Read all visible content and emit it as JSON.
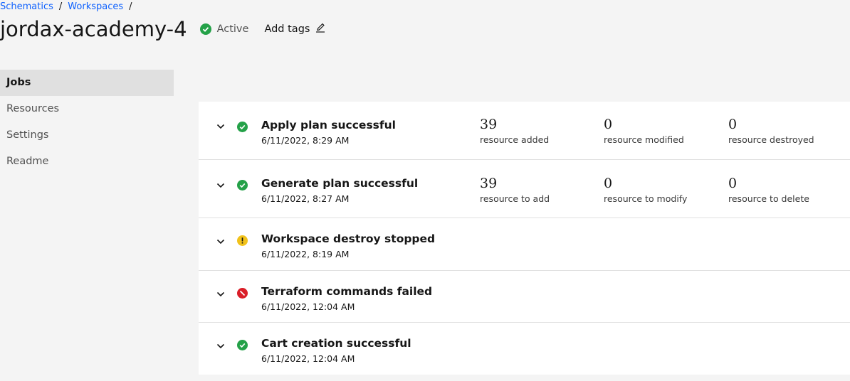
{
  "breadcrumb": {
    "items": [
      "Schematics",
      "Workspaces"
    ],
    "separator": "/"
  },
  "workspace": {
    "title": "jordax-academy-4",
    "status": "Active",
    "add_tags": "Add tags"
  },
  "nav": {
    "items": [
      "Jobs",
      "Resources",
      "Settings",
      "Readme"
    ],
    "active": "Jobs"
  },
  "colors": {
    "success": "#24a148",
    "warning": "#f1c21b",
    "error": "#da1e28",
    "link": "#0f62fe"
  },
  "jobs": [
    {
      "status": "success",
      "title": "Apply plan successful",
      "date": "6/11/2022, 8:29 AM",
      "metrics": [
        {
          "value": "39",
          "label": "resource added"
        },
        {
          "value": "0",
          "label": "resource modified"
        },
        {
          "value": "0",
          "label": "resource destroyed"
        }
      ]
    },
    {
      "status": "success",
      "title": "Generate plan successful",
      "date": "6/11/2022, 8:27 AM",
      "metrics": [
        {
          "value": "39",
          "label": "resource to add"
        },
        {
          "value": "0",
          "label": "resource to modify"
        },
        {
          "value": "0",
          "label": "resource to delete"
        }
      ]
    },
    {
      "status": "warning",
      "title": "Workspace destroy stopped",
      "date": "6/11/2022, 8:19 AM"
    },
    {
      "status": "error",
      "title": "Terraform commands failed",
      "date": "6/11/2022, 12:04 AM"
    },
    {
      "status": "success",
      "title": "Cart creation successful",
      "date": "6/11/2022, 12:04 AM"
    }
  ]
}
